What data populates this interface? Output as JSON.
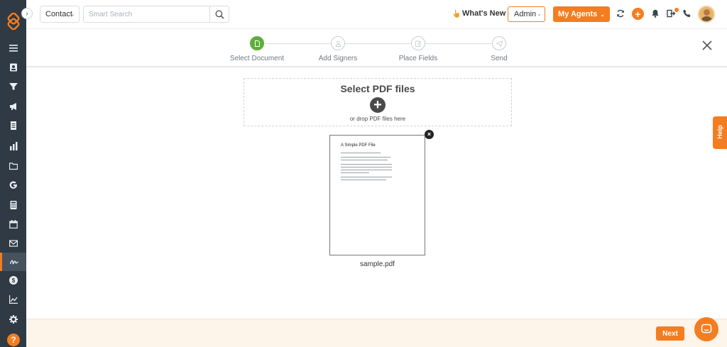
{
  "sidebar": {
    "collapse_glyph": "›",
    "help_glyph": "?",
    "items": [
      {
        "icon": "list-icon"
      },
      {
        "icon": "contact-card-icon"
      },
      {
        "icon": "funnel-icon"
      },
      {
        "icon": "megaphone-icon"
      },
      {
        "icon": "document-icon"
      },
      {
        "icon": "bar-chart-icon"
      },
      {
        "icon": "folder-icon"
      },
      {
        "icon": "google-icon"
      },
      {
        "icon": "calculator-icon"
      },
      {
        "icon": "calendar-icon"
      },
      {
        "icon": "mail-icon"
      },
      {
        "icon": "signature-icon",
        "active": true
      },
      {
        "icon": "dollar-icon"
      },
      {
        "icon": "line-chart-icon"
      },
      {
        "icon": "gear-icon"
      }
    ]
  },
  "topbar": {
    "contact_dropdown": "Contact",
    "search_placeholder": "Smart Search",
    "whats_new": "What's New",
    "admin_dropdown": "Admin",
    "agents_button": "My Agents",
    "plus_glyph": "+"
  },
  "stepper": {
    "steps": [
      {
        "label": "Select Document",
        "active": true
      },
      {
        "label": "Add Signers",
        "active": false
      },
      {
        "label": "Place Fields",
        "active": false
      },
      {
        "label": "Send",
        "active": false
      }
    ]
  },
  "upload": {
    "title": "Select PDF files",
    "plus_glyph": "+",
    "hint": "or drop PDF files here"
  },
  "file": {
    "name": "sample.pdf",
    "preview_title": "A Simple PDF File",
    "remove_glyph": "×"
  },
  "help_tab": "Help",
  "footer": {
    "next_button": "Next"
  },
  "colors": {
    "accent": "#f47d20",
    "sidebar": "#2f3a45",
    "step_active": "#5fae3c",
    "footer_bg": "#fdf4ea"
  }
}
